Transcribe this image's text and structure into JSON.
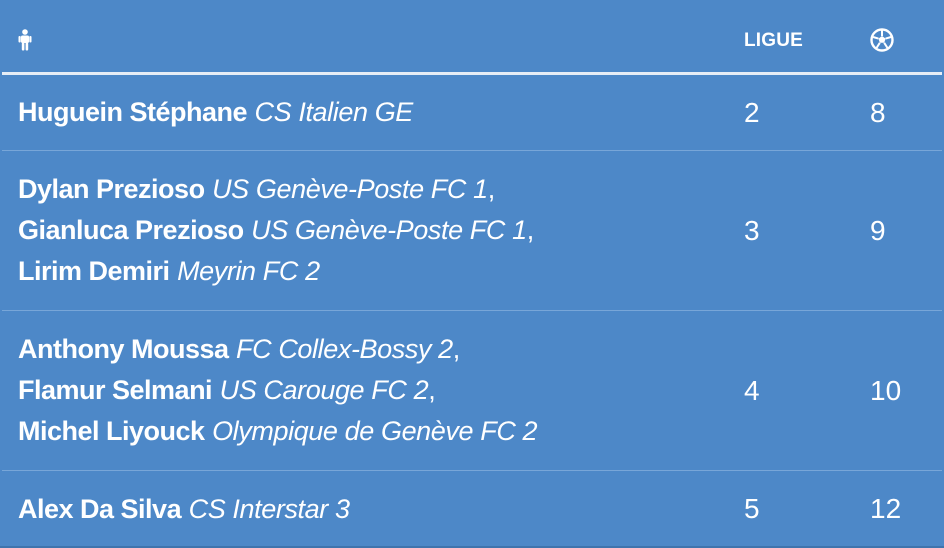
{
  "header": {
    "player_icon": "person-icon",
    "ligue_label": "LIGUE",
    "goals_icon": "soccer-ball-icon"
  },
  "rows": [
    {
      "entries": [
        {
          "player": "Huguein Stéphane",
          "club": "CS Italien GE",
          "sep": ""
        }
      ],
      "ligue": "2",
      "goals": "8"
    },
    {
      "entries": [
        {
          "player": "Dylan Prezioso",
          "club": "US Genève-Poste FC 1",
          "sep": ","
        },
        {
          "player": "Gianluca Prezioso",
          "club": "US Genève-Poste FC 1",
          "sep": ","
        },
        {
          "player": "Lirim Demiri",
          "club": "Meyrin FC 2",
          "sep": ""
        }
      ],
      "ligue": "3",
      "goals": "9"
    },
    {
      "entries": [
        {
          "player": "Anthony Moussa",
          "club": "FC Collex-Bossy 2",
          "sep": ","
        },
        {
          "player": "Flamur Selmani",
          "club": "US Carouge FC 2",
          "sep": ","
        },
        {
          "player": "Michel Liyouck",
          "club": "Olympique de Genève FC 2",
          "sep": ""
        }
      ],
      "ligue": "4",
      "goals": "10"
    },
    {
      "entries": [
        {
          "player": "Alex Da Silva",
          "club": "CS Interstar 3",
          "sep": ""
        }
      ],
      "ligue": "5",
      "goals": "12"
    }
  ]
}
